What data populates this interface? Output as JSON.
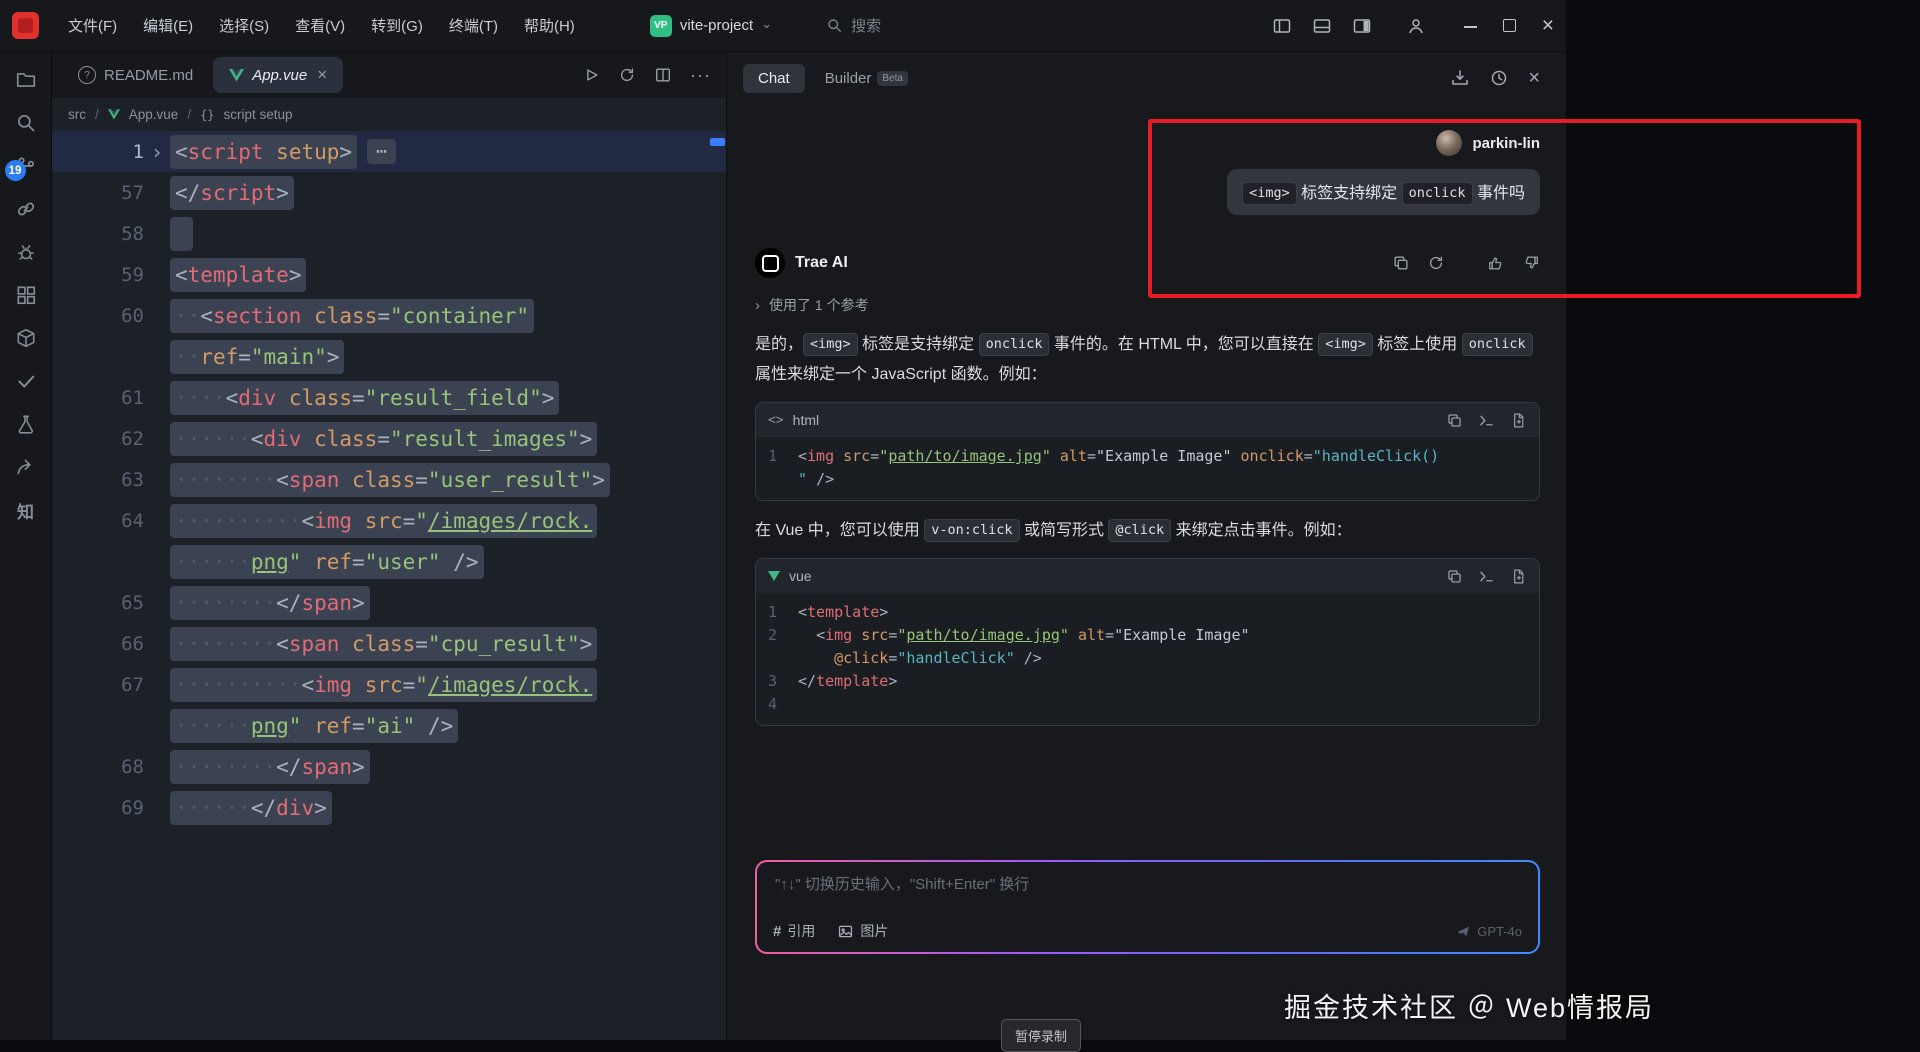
{
  "titlebar": {
    "menus": [
      "文件(F)",
      "编辑(E)",
      "选择(S)",
      "查看(V)",
      "转到(G)",
      "终端(T)",
      "帮助(H)"
    ],
    "project_badge": "VP",
    "project_name": "vite-project",
    "search_label": "搜索"
  },
  "activity_bar": {
    "source_control_badge": "19",
    "zhihu_label": "知"
  },
  "editor": {
    "tabs": [
      {
        "label": "README.md"
      },
      {
        "label": "App.vue",
        "close": "×"
      }
    ],
    "breadcrumb": [
      "src",
      "App.vue",
      "script setup"
    ],
    "breadcrumb_symbol": "{}",
    "folded_indicator": "⋯",
    "code_lines": [
      {
        "n": "1",
        "i": 0,
        "fold": true,
        "cur": true,
        "tk": [
          {
            "t": "<",
            "c": "p"
          },
          {
            "t": "script",
            "c": "tag"
          },
          {
            "t": " ",
            "c": "p"
          },
          {
            "t": "setup",
            "c": "attr"
          },
          {
            "t": ">",
            "c": "p"
          }
        ]
      },
      {
        "n": "57",
        "i": 0,
        "tk": [
          {
            "t": "</",
            "c": "p"
          },
          {
            "t": "script",
            "c": "tag"
          },
          {
            "t": ">",
            "c": "p"
          }
        ]
      },
      {
        "n": "58",
        "i": 0,
        "tk": []
      },
      {
        "n": "59",
        "i": 0,
        "tk": [
          {
            "t": "<",
            "c": "p"
          },
          {
            "t": "template",
            "c": "tag"
          },
          {
            "t": ">",
            "c": "p"
          }
        ]
      },
      {
        "n": "60",
        "i": 2,
        "tk": [
          {
            "t": "<",
            "c": "p"
          },
          {
            "t": "section",
            "c": "tag"
          },
          {
            "t": " ",
            "c": "p"
          },
          {
            "t": "class",
            "c": "attr"
          },
          {
            "t": "=",
            "c": "p"
          },
          {
            "t": "\"container\"",
            "c": "str"
          }
        ]
      },
      {
        "n": "",
        "i": 2,
        "tk": [
          {
            "t": "ref",
            "c": "attr"
          },
          {
            "t": "=",
            "c": "p"
          },
          {
            "t": "\"main\"",
            "c": "str"
          },
          {
            "t": ">",
            "c": "p"
          }
        ]
      },
      {
        "n": "61",
        "i": 4,
        "tk": [
          {
            "t": "<",
            "c": "p"
          },
          {
            "t": "div",
            "c": "tag"
          },
          {
            "t": " ",
            "c": "p"
          },
          {
            "t": "class",
            "c": "attr"
          },
          {
            "t": "=",
            "c": "p"
          },
          {
            "t": "\"result_field\"",
            "c": "str"
          },
          {
            "t": ">",
            "c": "p"
          }
        ]
      },
      {
        "n": "62",
        "i": 6,
        "tk": [
          {
            "t": "<",
            "c": "p"
          },
          {
            "t": "div",
            "c": "tag"
          },
          {
            "t": " ",
            "c": "p"
          },
          {
            "t": "class",
            "c": "attr"
          },
          {
            "t": "=",
            "c": "p"
          },
          {
            "t": "\"result_images\"",
            "c": "str"
          },
          {
            "t": ">",
            "c": "p"
          }
        ]
      },
      {
        "n": "63",
        "i": 8,
        "tk": [
          {
            "t": "<",
            "c": "p"
          },
          {
            "t": "span",
            "c": "tag"
          },
          {
            "t": " ",
            "c": "p"
          },
          {
            "t": "class",
            "c": "attr"
          },
          {
            "t": "=",
            "c": "p"
          },
          {
            "t": "\"user_result\"",
            "c": "str"
          },
          {
            "t": ">",
            "c": "p"
          }
        ]
      },
      {
        "n": "64",
        "i": 10,
        "tk": [
          {
            "t": "<",
            "c": "p"
          },
          {
            "t": "img",
            "c": "tag"
          },
          {
            "t": " ",
            "c": "p"
          },
          {
            "t": "src",
            "c": "attr"
          },
          {
            "t": "=",
            "c": "p"
          },
          {
            "t": "\"",
            "c": "str"
          },
          {
            "t": "/images/rock.",
            "c": "strl"
          }
        ]
      },
      {
        "n": "",
        "i": 6,
        "tk": [
          {
            "t": "png",
            "c": "strl"
          },
          {
            "t": "\"",
            "c": "str"
          },
          {
            "t": " ",
            "c": "p"
          },
          {
            "t": "ref",
            "c": "attr"
          },
          {
            "t": "=",
            "c": "p"
          },
          {
            "t": "\"user\"",
            "c": "str"
          },
          {
            "t": " ",
            "c": "p"
          },
          {
            "t": "/>",
            "c": "p"
          }
        ]
      },
      {
        "n": "65",
        "i": 8,
        "tk": [
          {
            "t": "</",
            "c": "p"
          },
          {
            "t": "span",
            "c": "tag"
          },
          {
            "t": ">",
            "c": "p"
          }
        ]
      },
      {
        "n": "66",
        "i": 8,
        "tk": [
          {
            "t": "<",
            "c": "p"
          },
          {
            "t": "span",
            "c": "tag"
          },
          {
            "t": " ",
            "c": "p"
          },
          {
            "t": "class",
            "c": "attr"
          },
          {
            "t": "=",
            "c": "p"
          },
          {
            "t": "\"cpu_result\"",
            "c": "str"
          },
          {
            "t": ">",
            "c": "p"
          }
        ]
      },
      {
        "n": "67",
        "i": 10,
        "tk": [
          {
            "t": "<",
            "c": "p"
          },
          {
            "t": "img",
            "c": "tag"
          },
          {
            "t": " ",
            "c": "p"
          },
          {
            "t": "src",
            "c": "attr"
          },
          {
            "t": "=",
            "c": "p"
          },
          {
            "t": "\"",
            "c": "str"
          },
          {
            "t": "/images/rock.",
            "c": "strl"
          }
        ]
      },
      {
        "n": "",
        "i": 6,
        "tk": [
          {
            "t": "png",
            "c": "strl"
          },
          {
            "t": "\"",
            "c": "str"
          },
          {
            "t": " ",
            "c": "p"
          },
          {
            "t": "ref",
            "c": "attr"
          },
          {
            "t": "=",
            "c": "p"
          },
          {
            "t": "\"ai\"",
            "c": "str"
          },
          {
            "t": " ",
            "c": "p"
          },
          {
            "t": "/>",
            "c": "p"
          }
        ]
      },
      {
        "n": "68",
        "i": 8,
        "tk": [
          {
            "t": "</",
            "c": "p"
          },
          {
            "t": "span",
            "c": "tag"
          },
          {
            "t": ">",
            "c": "p"
          }
        ]
      },
      {
        "n": "69",
        "i": 6,
        "tk": [
          {
            "t": "</",
            "c": "p"
          },
          {
            "t": "div",
            "c": "tag"
          },
          {
            "t": ">",
            "c": "p"
          }
        ]
      }
    ]
  },
  "chat": {
    "tab_chat": "Chat",
    "tab_builder": "Builder",
    "badge_beta": "Beta",
    "user": {
      "name": "parkin-lin",
      "message_parts": [
        {
          "t": "<img>",
          "code": true
        },
        {
          "t": " 标签支持绑定 ",
          "code": false
        },
        {
          "t": "onclick",
          "code": true
        },
        {
          "t": " 事件吗",
          "code": false
        }
      ]
    },
    "assistant": {
      "name": "Trae AI",
      "reference_text": "使用了 1 个参考"
    },
    "flow": [
      {
        "type": "p",
        "parts": [
          {
            "t": "是的，"
          },
          {
            "t": "<img>",
            "code": true
          },
          {
            "t": " 标签是支持绑定 "
          },
          {
            "t": "onclick",
            "code": true
          },
          {
            "t": " 事件的。在 HTML 中，您可以直接在 "
          },
          {
            "t": "<img>",
            "code": true
          },
          {
            "t": " 标签上使用 "
          },
          {
            "t": "onclick",
            "code": true
          },
          {
            "t": " 属性来绑定一个 JavaScript 函数。例如："
          }
        ]
      },
      {
        "type": "code",
        "lang": "html",
        "icon": "angle",
        "lines": [
          {
            "n": "1",
            "tk": [
              {
                "t": "<",
                "c": "p"
              },
              {
                "t": "img",
                "c": "tag"
              },
              {
                "t": " ",
                "c": "p"
              },
              {
                "t": "src",
                "c": "attr"
              },
              {
                "t": "=",
                "c": "p"
              },
              {
                "t": "\"",
                "c": "str"
              },
              {
                "t": "path/to/image.jpg",
                "c": "strl"
              },
              {
                "t": "\"",
                "c": "str"
              },
              {
                "t": " ",
                "c": "p"
              },
              {
                "t": "alt",
                "c": "attr"
              },
              {
                "t": "=",
                "c": "p"
              },
              {
                "t": "\"Example Image\"",
                "c": "lt"
              },
              {
                "t": " ",
                "c": "p"
              },
              {
                "t": "onclick",
                "c": "attr"
              },
              {
                "t": "=",
                "c": "p"
              },
              {
                "t": "\"handleClick()",
                "c": "cy"
              }
            ]
          },
          {
            "n": "",
            "tk": [
              {
                "t": "\"",
                "c": "cy"
              },
              {
                "t": " ",
                "c": "p"
              },
              {
                "t": "/>",
                "c": "p"
              }
            ]
          }
        ]
      },
      {
        "type": "p",
        "parts": [
          {
            "t": "在 Vue 中，您可以使用 "
          },
          {
            "t": "v-on:click",
            "code": true
          },
          {
            "t": " 或简写形式 "
          },
          {
            "t": "@click",
            "code": true
          },
          {
            "t": " 来绑定点击事件。例如："
          }
        ]
      },
      {
        "type": "code",
        "lang": "vue",
        "icon": "vue",
        "lines": [
          {
            "n": "1",
            "tk": [
              {
                "t": "<",
                "c": "p"
              },
              {
                "t": "template",
                "c": "tag"
              },
              {
                "t": ">",
                "c": "p"
              }
            ]
          },
          {
            "n": "2",
            "tk": [
              {
                "t": "  ",
                "c": "p"
              },
              {
                "t": "<",
                "c": "p"
              },
              {
                "t": "img",
                "c": "tag"
              },
              {
                "t": " ",
                "c": "p"
              },
              {
                "t": "src",
                "c": "attr"
              },
              {
                "t": "=",
                "c": "p"
              },
              {
                "t": "\"",
                "c": "str"
              },
              {
                "t": "path/to/image.jpg",
                "c": "strl"
              },
              {
                "t": "\"",
                "c": "str"
              },
              {
                "t": " ",
                "c": "p"
              },
              {
                "t": "alt",
                "c": "attr"
              },
              {
                "t": "=",
                "c": "p"
              },
              {
                "t": "\"Example Image\"",
                "c": "lt"
              }
            ]
          },
          {
            "n": "",
            "tk": [
              {
                "t": "    ",
                "c": "p"
              },
              {
                "t": "@click",
                "c": "attr"
              },
              {
                "t": "=",
                "c": "p"
              },
              {
                "t": "\"handleClick\"",
                "c": "cy"
              },
              {
                "t": " ",
                "c": "p"
              },
              {
                "t": "/>",
                "c": "p"
              }
            ]
          },
          {
            "n": "3",
            "tk": [
              {
                "t": "</",
                "c": "p"
              },
              {
                "t": "template",
                "c": "tag"
              },
              {
                "t": ">",
                "c": "p"
              }
            ]
          },
          {
            "n": "4",
            "tk": []
          }
        ]
      }
    ],
    "input": {
      "placeholder": "\"↑↓\" 切换历史输入，\"Shift+Enter\" 换行",
      "quote_label": "引用",
      "image_label": "图片",
      "model_label": "GPT-4o"
    }
  },
  "overlay": {
    "watermark": "掘金技术社区 ＠ Web情报局",
    "recording_label": "暂停录制"
  }
}
